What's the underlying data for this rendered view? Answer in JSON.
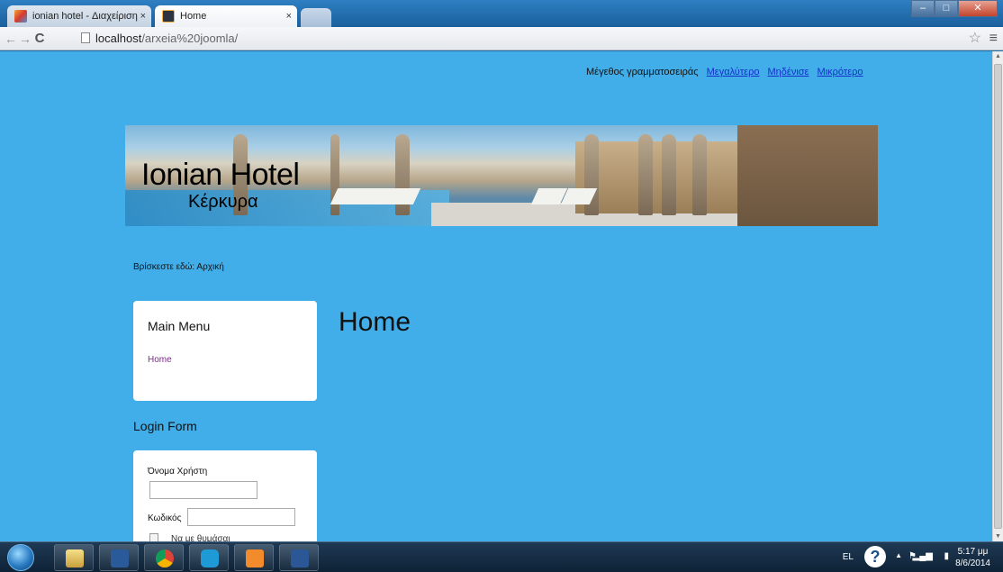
{
  "browser": {
    "tabs": [
      {
        "title": "ionian hotel - Διαχείριση"
      },
      {
        "title": "Home"
      }
    ],
    "tab_close": "×",
    "window_buttons": {
      "minimize": "–",
      "maximize": "□",
      "close": "✕"
    },
    "nav": {
      "back": "←",
      "forward": "→",
      "reload": "C"
    },
    "url_host": "localhost",
    "url_path": "/arxeia%20joomla/",
    "star": "☆",
    "menu": "≡"
  },
  "page": {
    "font_size_label": "Μέγεθος γραμματοσειράς",
    "font_size_links": {
      "bigger": "Μεγαλύτερο",
      "reset": "Μηδένισε",
      "smaller": "Μικρότερο"
    },
    "site_name": "Ionian Hotel",
    "site_subtitle": "Κέρκυρα",
    "breadcrumb": "Βρίσκεστε εδώ: Αρχική",
    "main_menu": {
      "title": "Main Menu",
      "items": [
        "Home"
      ]
    },
    "login_form": {
      "title": "Login Form",
      "username_label": "Όνομα Χρήστη",
      "password_label": "Κωδικός",
      "remember_label": "Να με θυμάσαι"
    },
    "content_title": "Home"
  },
  "taskbar": {
    "language": "EL",
    "help": "?",
    "tray_arrow": "▲",
    "time": "5:17 μμ",
    "date": "8/6/2014"
  },
  "colors": {
    "page_background": "#41aeea",
    "link": "#1430c8",
    "visited_link": "#7d2a8c"
  }
}
